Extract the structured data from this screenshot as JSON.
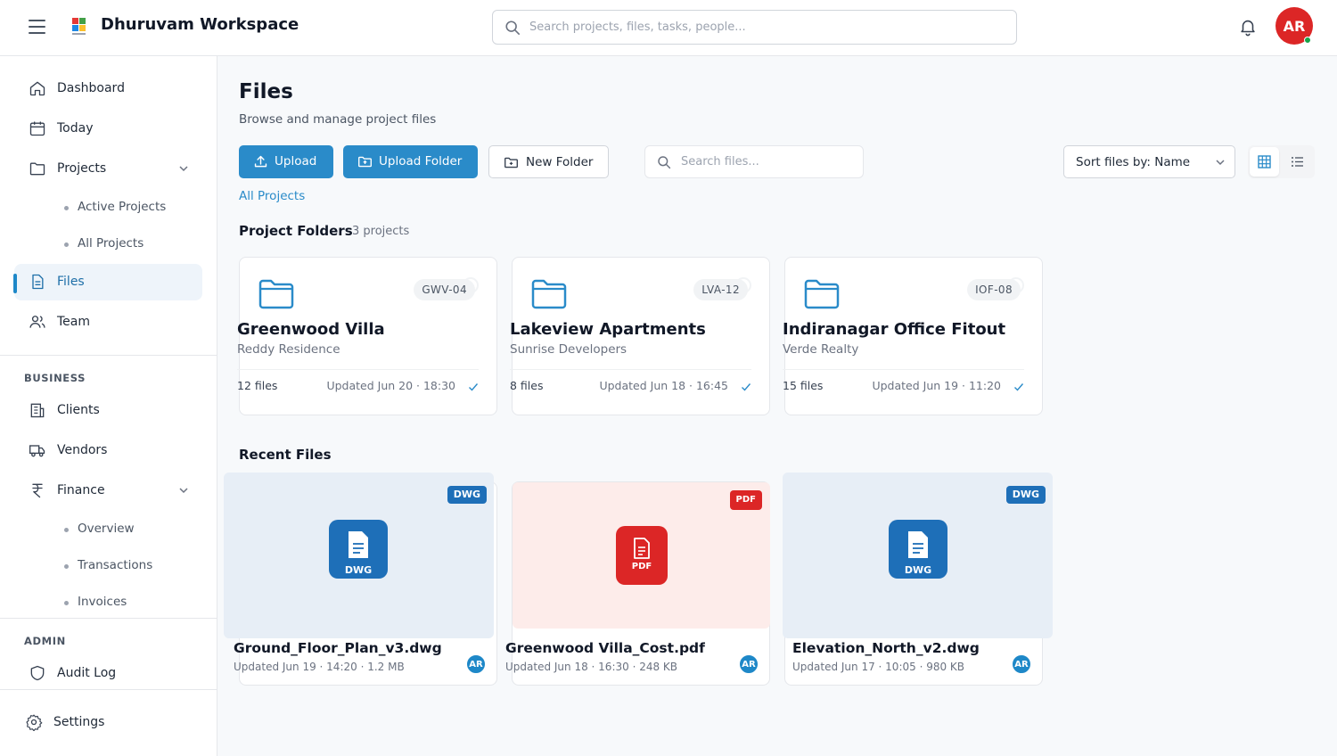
{
  "header": {
    "app_title": "Dhuruvam Workspace",
    "search_placeholder": "Search projects, files, tasks, people...",
    "avatar_initials": "AR",
    "avatar_color": "#dc2626"
  },
  "sidebar": {
    "items": [
      {
        "label": "Dashboard",
        "icon": "home-icon"
      },
      {
        "label": "Today",
        "icon": "calendar-icon"
      },
      {
        "label": "Projects",
        "icon": "folder-icon"
      },
      {
        "label": "Files",
        "icon": "file-icon"
      },
      {
        "label": "Team",
        "icon": "users-icon"
      }
    ],
    "projects_sub": [
      "Active Projects",
      "All Projects"
    ],
    "business_label": "BUSINESS",
    "business_items": [
      {
        "label": "Clients",
        "icon": "building-icon"
      },
      {
        "label": "Vendors",
        "icon": "truck-icon"
      },
      {
        "label": "Finance",
        "icon": "rupee-icon"
      }
    ],
    "finance_sub": [
      "Overview",
      "Transactions",
      "Invoices"
    ],
    "admin_label": "ADMIN",
    "admin_items": [
      {
        "label": "Audit Log",
        "icon": "shield-icon"
      }
    ],
    "settings_label": "Settings",
    "active_item": "Files"
  },
  "main": {
    "title": "Files",
    "subtitle": "Browse and manage project files",
    "upload_label": "Upload",
    "upload_folder_label": "Upload Folder",
    "new_folder_label": "New Folder",
    "search_placeholder": "Search files...",
    "sort_label": "Sort files by: Name",
    "view_mode": "grid",
    "breadcrumb": "All Projects",
    "project_folders_heading": "Project Folders",
    "project_folders_count": "3 projects",
    "recent_heading": "Recent Files",
    "accent_color": "#2a8bc9"
  },
  "folders": [
    {
      "code": "GWV-04",
      "name": "Greenwood Villa",
      "client": "Reddy Residence",
      "files": "12 files",
      "updated": "Updated Jun 20 · 18:30"
    },
    {
      "code": "LVA-12",
      "name": "Lakeview Apartments",
      "client": "Sunrise Developers",
      "files": "8 files",
      "updated": "Updated Jun 18 · 16:45"
    },
    {
      "code": "IOF-08",
      "name": "Indiranagar Office Fitout",
      "client": "Verde Realty",
      "files": "15 files",
      "updated": "Updated Jun 19 · 11:20"
    }
  ],
  "recent_files": [
    {
      "name": "Ground_Floor_Plan_v3.dwg",
      "meta": "Updated Jun 19 · 14:20 · 1.2 MB",
      "type": "DWG",
      "badge_color": "#1e6fb8",
      "owner": "AR"
    },
    {
      "name": "Greenwood Villa_Cost.pdf",
      "meta": "Updated Jun 18 · 16:30 · 248 KB",
      "type": "PDF",
      "badge_color": "#dc2626",
      "owner": "AR"
    },
    {
      "name": "Elevation_North_v2.dwg",
      "meta": "Updated Jun 17 · 10:05 · 980 KB",
      "type": "DWG",
      "badge_color": "#1e6fb8",
      "owner": "AR"
    }
  ]
}
